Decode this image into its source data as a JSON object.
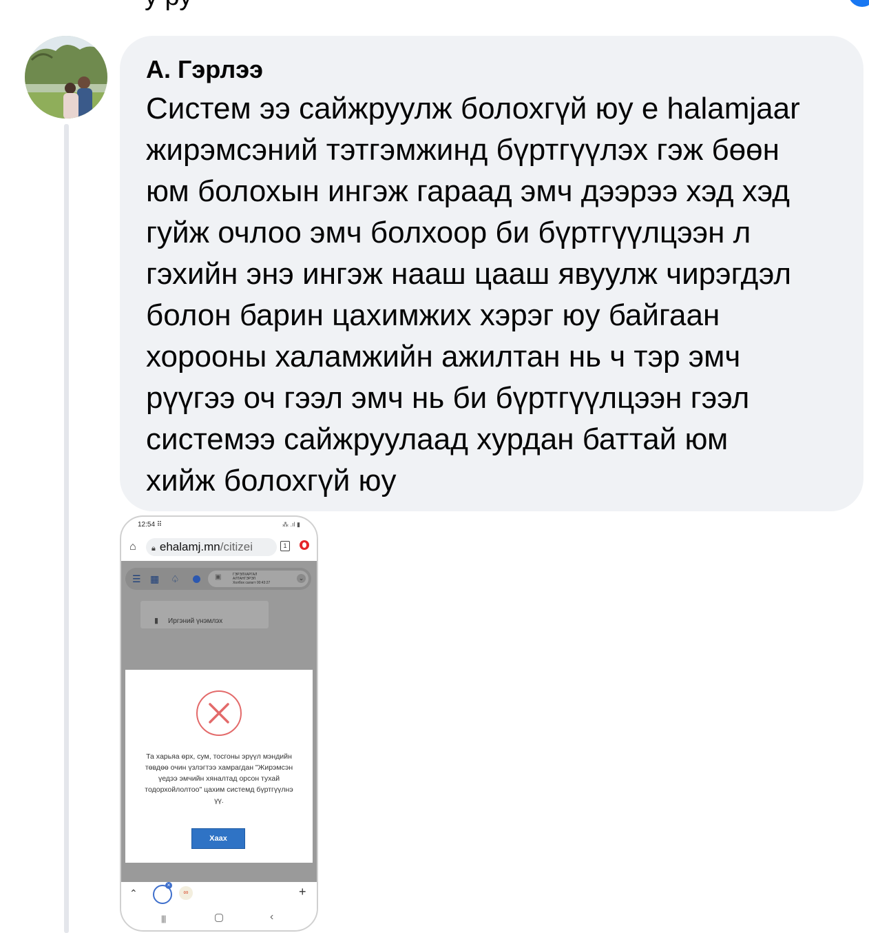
{
  "previous_comment": {
    "text": "у                    ру"
  },
  "comment": {
    "author": "А. Гэрлээ",
    "text_lines": [
      "Систем ээ сайжруулж болохгүй юу е halamjaar",
      "жирэмсэний тэтгэмжинд бүртгүүлэх гэж бөөн",
      "юм болохын ингэж гараад эмч дээрээ хэд хэд",
      "гуйж очлоо эмч болхоор би бүртгүүлцээн  л",
      "гэхийн энэ ингэж нааш цааш явуулж чирэгдэл",
      "болон барин цахимжих хэрэг юу байгаан",
      "хорооны халамжийн ажилтан нь ч тэр эмч",
      "рүүгээ оч гээл эмч нь би бүртгүүлцээн гээл",
      "системээ сайжруулаад хурдан баттай юм",
      "хийж болохгүй юу"
    ]
  },
  "screenshot": {
    "status_time": "12:54 ⠿",
    "url_host": "ehalamj.mn",
    "url_path": "/citizei",
    "tab_count": "1",
    "user_name_line1": "ГЭРЭЛХАРГАЛ",
    "user_name_line2": "АЛТАНГЭРЭЛ",
    "session_label": "Холбох салагт   00:43:27",
    "card_label": "Иргэний үнэмлэх",
    "modal_message": "Та харьяа өрх, сум, тосгоны эрүүл мэндийн төвдөө очин үзлэгтээ хамрагдан \"Жирэмсэн үедээ эмчийн хяналтад орсон тухай тодорхойлолтоо\" цахим системд бүртгүүлнэ үү.",
    "close_button": "Хаах"
  }
}
